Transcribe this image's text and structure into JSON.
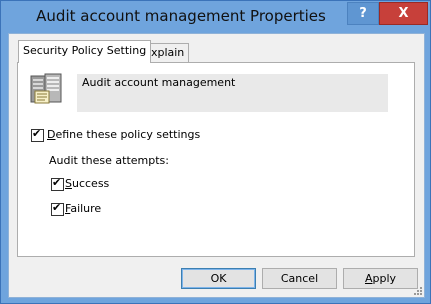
{
  "window": {
    "title": "Audit account management Properties",
    "help_label": "?",
    "close_label": "X"
  },
  "tabs": [
    {
      "label": "Security Policy Setting",
      "active": true
    },
    {
      "label": "Explain",
      "active": false
    }
  ],
  "policy": {
    "name": "Audit account management",
    "icon": "policy-server-icon"
  },
  "define": {
    "checked": true,
    "label_first": "D",
    "label_rest": "efine these policy settings"
  },
  "audit": {
    "heading": "Audit these attempts:",
    "success": {
      "checked": true,
      "label_first": "S",
      "label_rest": "uccess"
    },
    "failure": {
      "checked": true,
      "label_first": "F",
      "label_rest": "ailure"
    }
  },
  "buttons": {
    "ok": "OK",
    "cancel": "Cancel",
    "apply_first": "A",
    "apply_rest": "pply"
  },
  "colors": {
    "frame": "#6fa4dd",
    "close_button": "#c7403a"
  }
}
